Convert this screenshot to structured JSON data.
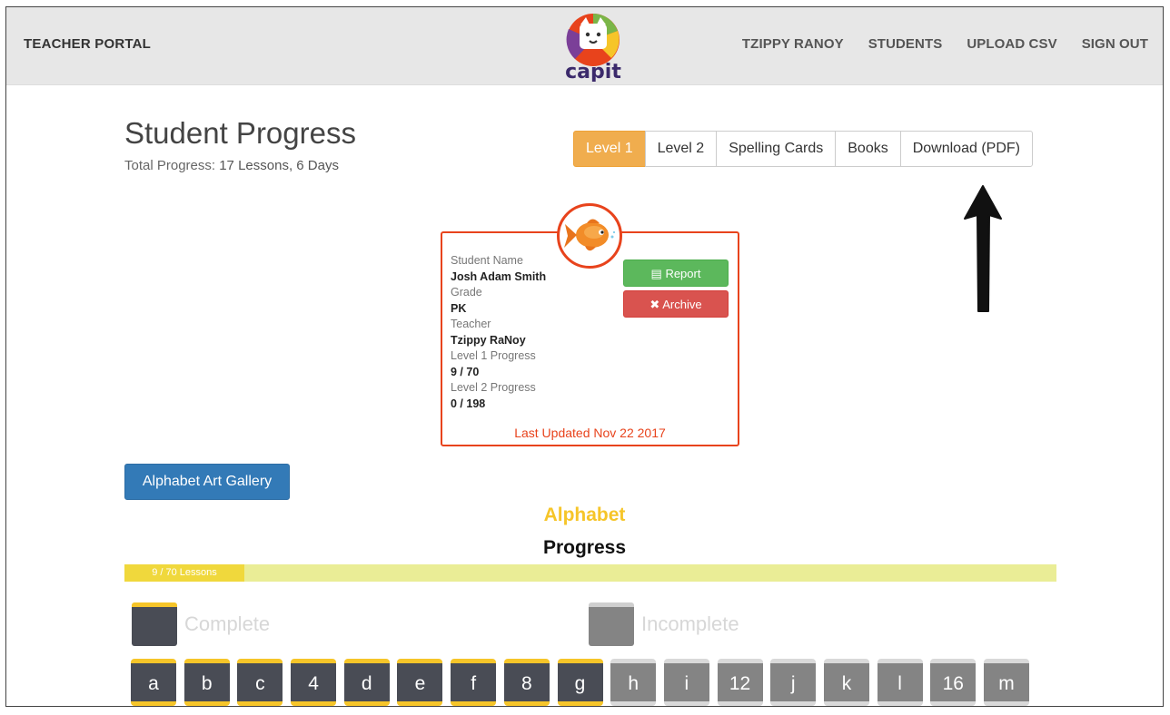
{
  "navbar": {
    "brand": "TEACHER PORTAL",
    "logo_text": "capit",
    "links": [
      "TZIPPY RANOY",
      "STUDENTS",
      "UPLOAD CSV",
      "SIGN OUT"
    ]
  },
  "header": {
    "title": "Student Progress",
    "total_label": "Total Progress:",
    "total_value": "17 Lessons, 6 Days"
  },
  "tabs": [
    "Level 1",
    "Level 2",
    "Spelling Cards",
    "Books",
    "Download (PDF)"
  ],
  "student": {
    "name_label": "Student Name",
    "name": "Josh Adam Smith",
    "grade_label": "Grade",
    "grade": "PK",
    "teacher_label": "Teacher",
    "teacher": "Tzippy RaNoy",
    "level1_label": "Level 1 Progress",
    "level1": "9 / 70",
    "level2_label": "Level 2 Progress",
    "level2": "0 / 198",
    "report_label": "Report",
    "archive_label": "Archive",
    "last_updated": "Last Updated Nov 22 2017",
    "avatar_icon": "goldfish-icon"
  },
  "gallery_button": "Alphabet Art Gallery",
  "section": {
    "title": "Alphabet",
    "subtitle": "Progress",
    "progress_text": "9 / 70 Lessons",
    "progress_fraction": 0.1286
  },
  "legend": {
    "complete": "Complete",
    "incomplete": "Incomplete"
  },
  "colors": {
    "accent_orange": "#f0ad4e",
    "card_border": "#e8431c",
    "complete_tile": "#494c55",
    "incomplete_tile": "#848484",
    "highlight_yellow": "#f6c529"
  },
  "lessons": [
    {
      "label": "a",
      "complete": true
    },
    {
      "label": "b",
      "complete": true
    },
    {
      "label": "c",
      "complete": true
    },
    {
      "label": "4",
      "complete": true
    },
    {
      "label": "d",
      "complete": true
    },
    {
      "label": "e",
      "complete": true
    },
    {
      "label": "f",
      "complete": true
    },
    {
      "label": "8",
      "complete": true
    },
    {
      "label": "g",
      "complete": true
    },
    {
      "label": "h",
      "complete": false
    },
    {
      "label": "i",
      "complete": false
    },
    {
      "label": "12",
      "complete": false
    },
    {
      "label": "j",
      "complete": false
    },
    {
      "label": "k",
      "complete": false
    },
    {
      "label": "l",
      "complete": false
    },
    {
      "label": "16",
      "complete": false
    },
    {
      "label": "m",
      "complete": false
    }
  ]
}
